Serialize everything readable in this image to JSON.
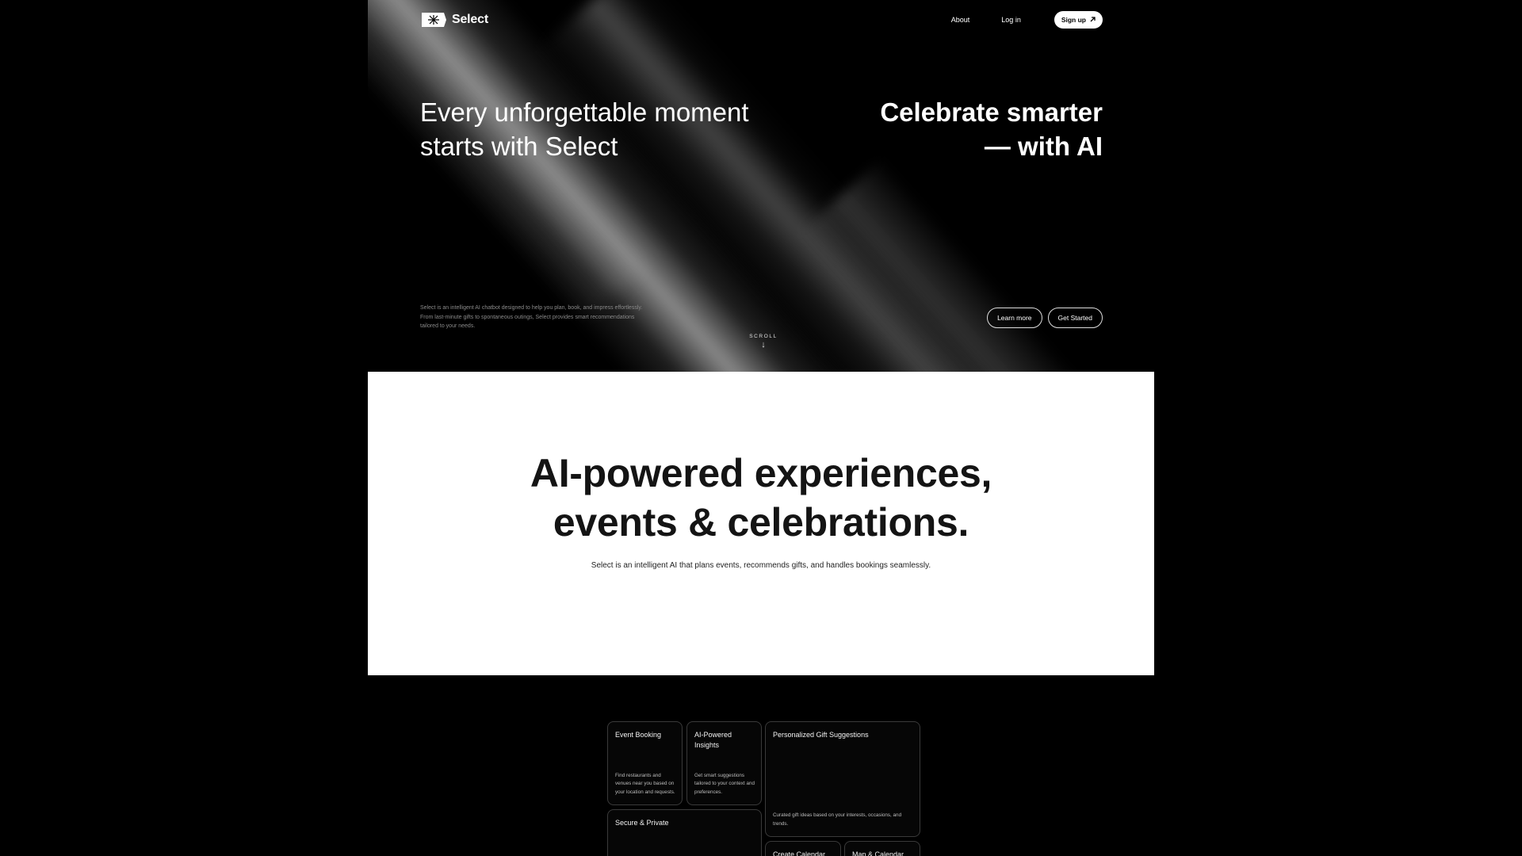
{
  "nav": {
    "brand": "Select",
    "about": "About",
    "login": "Log in",
    "signup": "Sign up"
  },
  "hero": {
    "headline_left": "Every unforgettable moment starts with Select",
    "headline_right_line1": "Celebrate smarter",
    "headline_right_line2": "— with AI",
    "description": "Select is an intelligent AI chatbot designed to help you plan, book, and impress effortlessly. From last-minute gifts to spontaneous outings, Select provides smart recommendations tailored to your needs.",
    "scroll_label": "SCROLL",
    "learn_more": "Learn more",
    "get_started": "Get Started"
  },
  "intro": {
    "title_line1": "AI-powered experiences,",
    "title_line2": "events & celebrations.",
    "subtitle": "Select is an intelligent AI that plans events, recommends gifts, and handles bookings seamlessly."
  },
  "features": [
    {
      "title": "Event Booking",
      "desc": "Find restaurants and venues near you based on your location and requests."
    },
    {
      "title": "AI-Powered Insights",
      "desc": "Get smart suggestions tailored to your context and preferences."
    },
    {
      "title": "Personalized Gift Suggestions",
      "desc": "Curated gift ideas based on your interests, occasions, and trends."
    },
    {
      "title": "Secure & Private",
      "desc": ""
    },
    {
      "title": "Create Calendar",
      "desc": ""
    },
    {
      "title": "Map & Calendar",
      "desc": ""
    }
  ],
  "colors": {
    "background": "#000000",
    "accent": "#ffffff",
    "muted_text": "#8a8a8a"
  }
}
